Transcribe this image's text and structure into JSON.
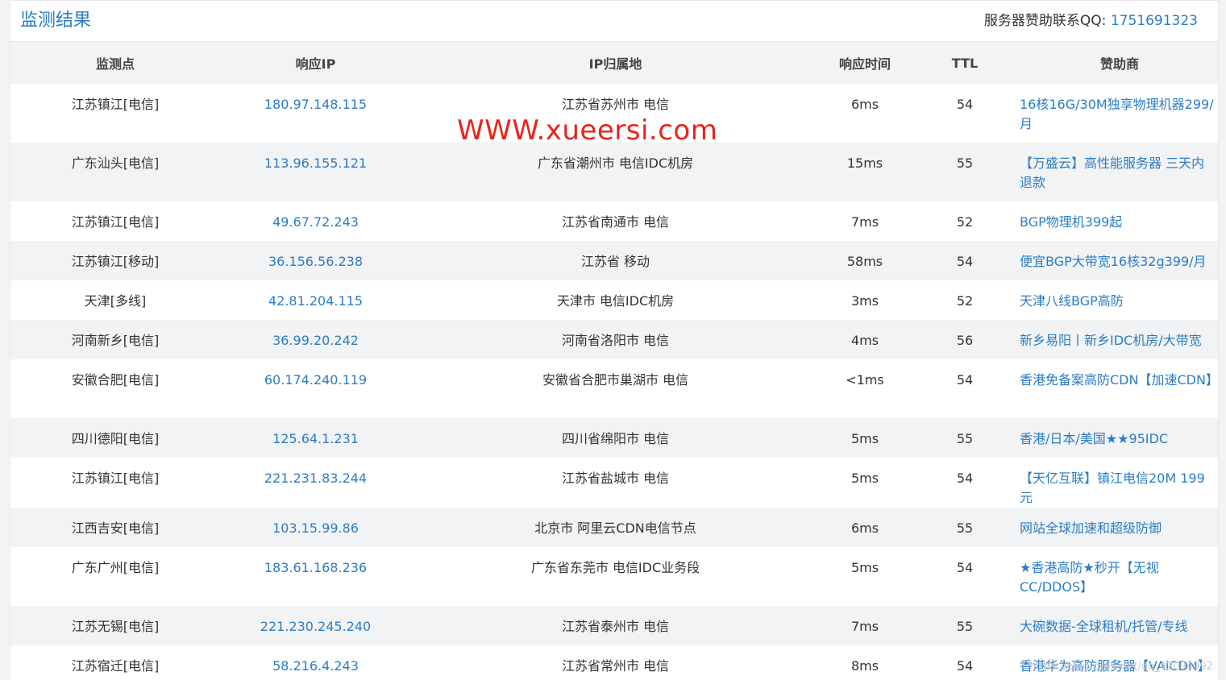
{
  "header": {
    "title": "监测结果",
    "contact_label": "服务器赞助联系QQ:",
    "contact_qq": "1751691323"
  },
  "columns": [
    "监测点",
    "响应IP",
    "IP归属地",
    "响应时间",
    "TTL",
    "赞助商"
  ],
  "rows": [
    {
      "point": "江苏镇江[电信]",
      "ip": "180.97.148.115",
      "location": "江苏省苏州市 电信",
      "time": "6ms",
      "ttl": "54",
      "sponsor": "16核16G/30M独享物理机器299/月"
    },
    {
      "point": "广东汕头[电信]",
      "ip": "113.96.155.121",
      "location": "广东省潮州市 电信IDC机房",
      "time": "15ms",
      "ttl": "55",
      "sponsor": "【万盛云】高性能服务器 三天内退款"
    },
    {
      "point": "江苏镇江[电信]",
      "ip": "49.67.72.243",
      "location": "江苏省南通市 电信",
      "time": "7ms",
      "ttl": "52",
      "sponsor": "BGP物理机399起"
    },
    {
      "point": "江苏镇江[移动]",
      "ip": "36.156.56.238",
      "location": "江苏省 移动",
      "time": "58ms",
      "ttl": "54",
      "sponsor": "便宜BGP大带宽16核32g399/月"
    },
    {
      "point": "天津[多线]",
      "ip": "42.81.204.115",
      "location": "天津市 电信IDC机房",
      "time": "3ms",
      "ttl": "52",
      "sponsor": "天津八线BGP高防"
    },
    {
      "point": "河南新乡[电信]",
      "ip": "36.99.20.242",
      "location": "河南省洛阳市 电信",
      "time": "4ms",
      "ttl": "56",
      "sponsor": "新乡易阳丨新乡IDC机房/大带宽"
    },
    {
      "point": "安徽合肥[电信]",
      "ip": "60.174.240.119",
      "location": "安徽省合肥市巢湖市 电信",
      "time": "<1ms",
      "ttl": "54",
      "sponsor": "香港免备案高防CDN【加速CDN】"
    },
    {
      "point": "四川德阳[电信]",
      "ip": "125.64.1.231",
      "location": "四川省绵阳市 电信",
      "time": "5ms",
      "ttl": "55",
      "sponsor": "香港/日本/美国★★95IDC"
    },
    {
      "point": "江苏镇江[电信]",
      "ip": "221.231.83.244",
      "location": "江苏省盐城市 电信",
      "time": "5ms",
      "ttl": "54",
      "sponsor": "【天亿互联】镇江电信20M 199元"
    },
    {
      "point": "江西吉安[电信]",
      "ip": "103.15.99.86",
      "location": "北京市 阿里云CDN电信节点",
      "time": "6ms",
      "ttl": "55",
      "sponsor": "网站全球加速和超级防御"
    },
    {
      "point": "广东广州[电信]",
      "ip": "183.61.168.236",
      "location": "广东省东莞市 电信IDC业务段",
      "time": "5ms",
      "ttl": "54",
      "sponsor": "★香港高防★秒开【无视CC/DDOS】"
    },
    {
      "point": "江苏无锡[电信]",
      "ip": "221.230.245.240",
      "location": "江苏省泰州市 电信",
      "time": "7ms",
      "ttl": "55",
      "sponsor": "大碗数据-全球租机/托管/专线"
    },
    {
      "point": "江苏宿迁[电信]",
      "ip": "58.216.4.243",
      "location": "江苏省常州市 电信",
      "time": "8ms",
      "ttl": "54",
      "sponsor": "香港华为高防服务器【VAiCDN】"
    }
  ],
  "watermark": "WWW.xueersi.com",
  "csdn_watermark": "https://blog.csdn.net/qq_42094992"
}
